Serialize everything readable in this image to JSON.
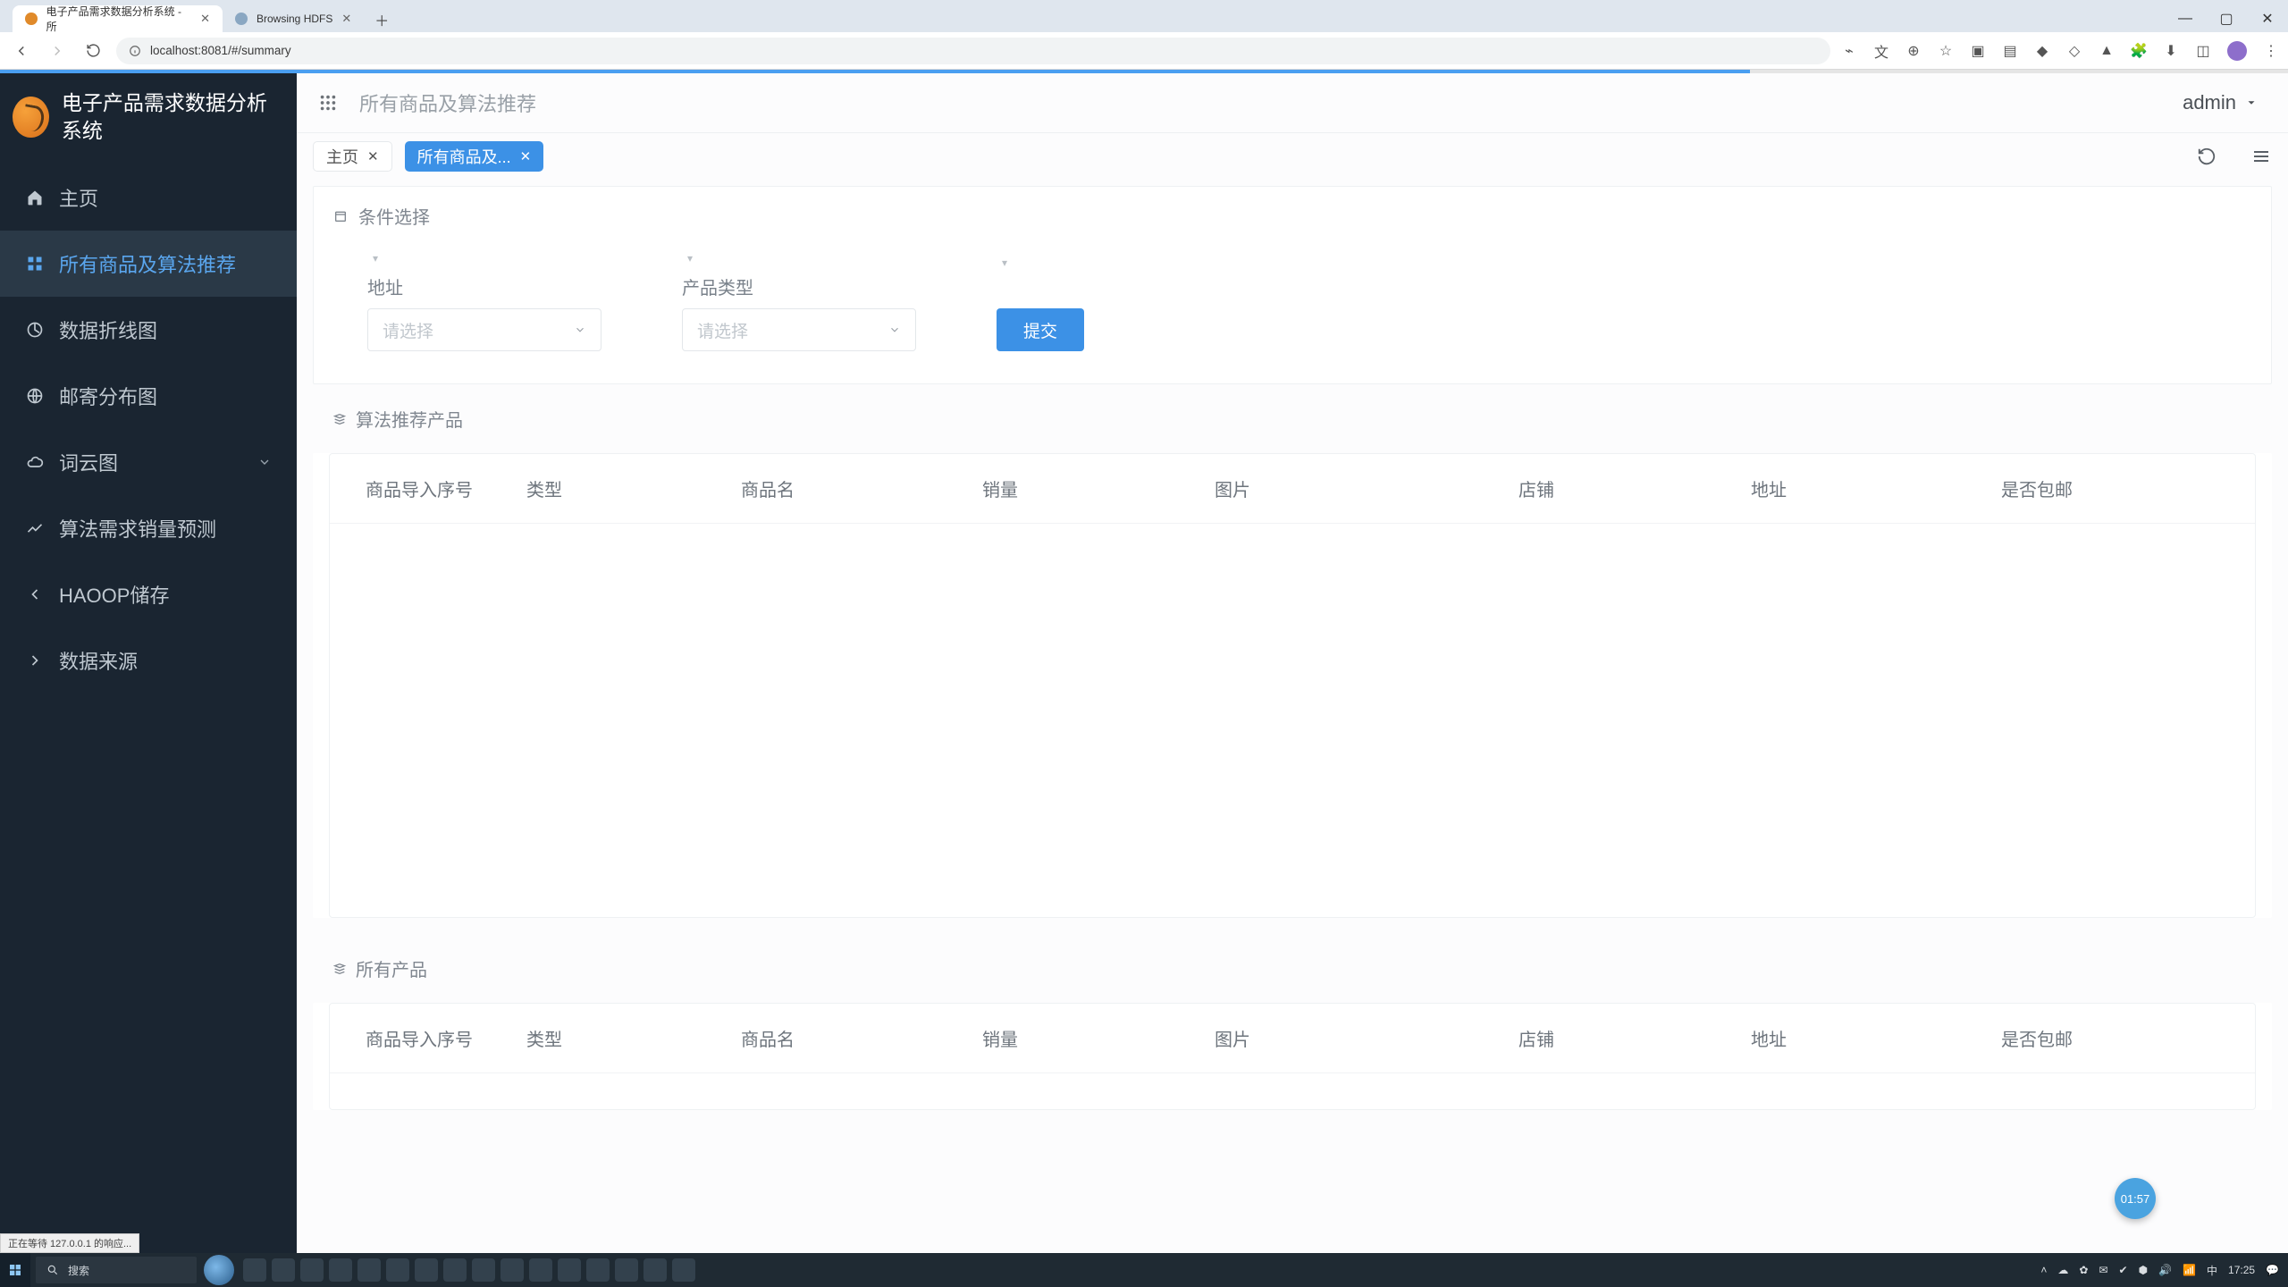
{
  "browser": {
    "tabs": [
      {
        "title": "电子产品需求数据分析系统 - 所",
        "active": true
      },
      {
        "title": "Browsing HDFS",
        "active": false
      }
    ],
    "url": "localhost:8081/#/summary"
  },
  "brand": {
    "title": "电子产品需求数据分析系统"
  },
  "sidebar": {
    "items": [
      {
        "icon": "home-icon",
        "label": "主页"
      },
      {
        "icon": "grid-icon",
        "label": "所有商品及算法推荐",
        "active": true
      },
      {
        "icon": "chart-icon",
        "label": "数据折线图"
      },
      {
        "icon": "globe-icon",
        "label": "邮寄分布图"
      },
      {
        "icon": "cloud-icon",
        "label": "词云图",
        "chevron": true
      },
      {
        "icon": "trend-icon",
        "label": "算法需求销量预测"
      },
      {
        "icon": "arrow-left-icon",
        "label": "HAOOP储存"
      },
      {
        "icon": "arrow-right-icon",
        "label": "数据来源"
      }
    ]
  },
  "topbar": {
    "page_title": "所有商品及算法推荐",
    "user": "admin"
  },
  "page_tabs": {
    "items": [
      {
        "label": "主页",
        "variant": "plain"
      },
      {
        "label": "所有商品及...",
        "variant": "primary"
      }
    ]
  },
  "filters": {
    "panel_title": "条件选择",
    "address_label": "地址",
    "product_type_label": "产品类型",
    "select_placeholder": "请选择",
    "submit_label": "提交"
  },
  "rec": {
    "panel_title": "算法推荐产品",
    "columns": [
      "商品导入序号",
      "类型",
      "商品名",
      "销量",
      "图片",
      "店铺",
      "地址",
      "是否包邮"
    ]
  },
  "all": {
    "panel_title": "所有产品",
    "columns": [
      "商品导入序号",
      "类型",
      "商品名",
      "销量",
      "图片",
      "店铺",
      "地址",
      "是否包邮"
    ]
  },
  "float_badge": "01:57",
  "status_strip": "正在等待 127.0.0.1 的响应...",
  "taskbar": {
    "search_placeholder": "搜索",
    "time": "17:25",
    "date": "",
    "lang": "中"
  }
}
